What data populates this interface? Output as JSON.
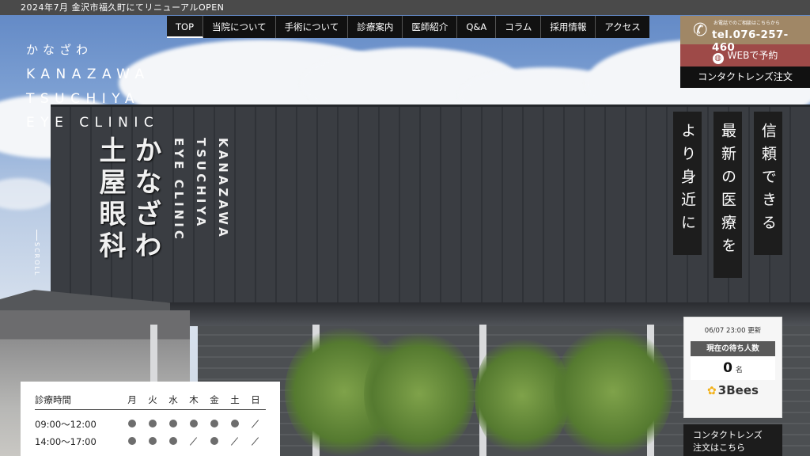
{
  "topbar": {
    "notice": "2024年7月 金沢市福久町にてリニューアルOPEN"
  },
  "nav": {
    "items": [
      {
        "label": "TOP",
        "name": "nav-top",
        "active": true
      },
      {
        "label": "当院について",
        "name": "nav-about"
      },
      {
        "label": "手術について",
        "name": "nav-surgery"
      },
      {
        "label": "診療案内",
        "name": "nav-treatment"
      },
      {
        "label": "医師紹介",
        "name": "nav-doctor"
      },
      {
        "label": "Q&A",
        "name": "nav-qa"
      },
      {
        "label": "コラム",
        "name": "nav-column"
      },
      {
        "label": "採用情報",
        "name": "nav-recruit"
      },
      {
        "label": "アクセス",
        "name": "nav-access"
      }
    ]
  },
  "contact": {
    "tel_caption": "お電話でのご相談はこちらから",
    "tel": "tel.076-257-460",
    "web": "WEBで予約",
    "lens": "コンタクトレンズ注文"
  },
  "logo": {
    "kana": "かなざわ",
    "en_lines": [
      "KANAZAWA",
      "TSUCHIYA",
      "EYE CLINIC"
    ]
  },
  "sign": {
    "jp_col1": "かなざわ",
    "jp_col2": "土屋眼科",
    "en_col1": "KANAZAWA",
    "en_col2": "TSUCHIYA",
    "en_col3": "EYE CLINIC"
  },
  "catch": [
    "信頼できる",
    "最新の医療を",
    "より身近に"
  ],
  "scroll": "SCROLL",
  "wait": {
    "updated": "06/07 23:00 更新",
    "label": "現在の待ち人数",
    "count": "0",
    "unit": "名",
    "brand": "3Bees"
  },
  "lens_cta": [
    "コンタクトレンズ",
    "注文はこちら"
  ],
  "hours": {
    "header": "診療時間",
    "days": [
      "月",
      "火",
      "水",
      "木",
      "金",
      "土",
      "日"
    ],
    "rows": [
      {
        "time": "09:00〜12:00",
        "marks": [
          "dot",
          "dot",
          "dot",
          "dot",
          "dot",
          "dot",
          "slash"
        ]
      },
      {
        "time": "14:00〜17:00",
        "marks": [
          "dot",
          "dot",
          "dot",
          "slash",
          "dot",
          "slash",
          "slash"
        ]
      }
    ]
  },
  "colors": {
    "nav_bg": "#111111",
    "tel_bg": "#a08766",
    "web_bg": "#9e4a48",
    "dark_panel": "#1d1d1d"
  }
}
